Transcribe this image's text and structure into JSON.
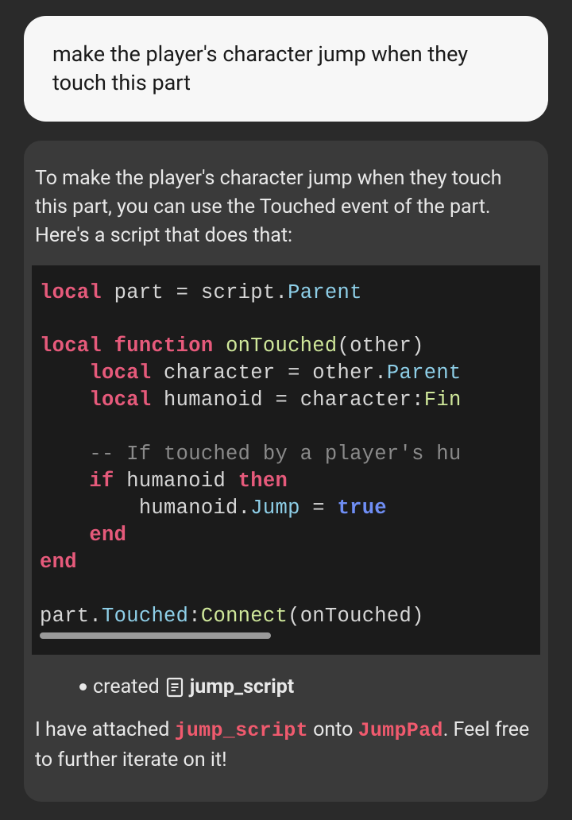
{
  "user": {
    "message": "make the player's character jump when they touch this part"
  },
  "assistant": {
    "intro": "To make the player's character jump when they touch this part, you can use the Touched event of the part. Here's a script that does that:",
    "created_label": "created",
    "created_name": "jump_script",
    "outro_pre": "I have attached ",
    "outro_hl1": "jump_script",
    "outro_mid": " onto ",
    "outro_hl2": "JumpPad",
    "outro_post": ". Feel free to further iterate on it!"
  },
  "code": {
    "t": {
      "local": "local",
      "function": "function",
      "if": "if",
      "then": "then",
      "end": "end",
      "true": "true",
      "part": "part",
      "eq": " = ",
      "script": "script",
      "dot": ".",
      "colon": ":",
      "Parent": "Parent",
      "onTouched": "onTouched",
      "lparen": "(",
      "rparen": ")",
      "other": "other",
      "character": "character",
      "humanoid": "humanoid",
      "Fin": "Fin",
      "comment": "-- If touched by a player's hu",
      "Jump": "Jump",
      "Touched": "Touched",
      "Connect": "Connect",
      "sp": " ",
      "indent1": "    ",
      "indent2": "        "
    }
  },
  "icons": {
    "script": "script-icon",
    "bullet": "bullet-icon"
  }
}
